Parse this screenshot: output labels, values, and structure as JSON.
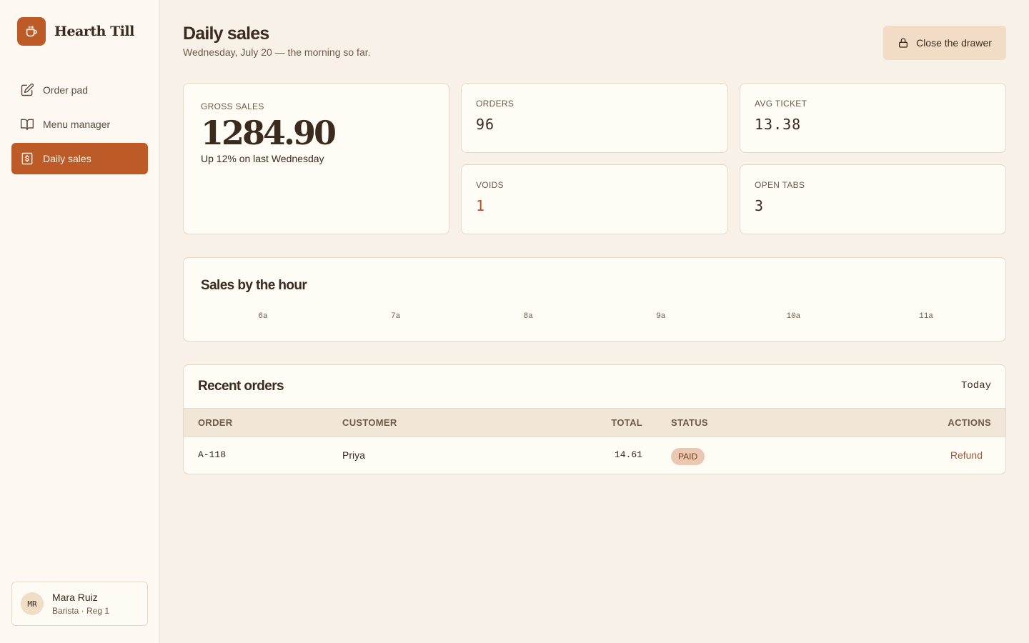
{
  "app": {
    "name": "Hearth Till"
  },
  "nav": {
    "items": [
      {
        "label": "Order pad"
      },
      {
        "label": "Menu manager"
      },
      {
        "label": "Daily sales"
      }
    ]
  },
  "user": {
    "initials": "MR",
    "name": "Mara Ruiz",
    "role": "Barista · Reg 1"
  },
  "header": {
    "title": "Daily sales",
    "subtitle": "Wednesday, July 20 — the morning so far.",
    "drawer_button": "Close the drawer"
  },
  "stats": {
    "gross": {
      "label": "Gross sales",
      "value": "1284.90",
      "note": "Up 12% on last Wednesday"
    },
    "orders": {
      "label": "Orders",
      "value": "96"
    },
    "avg_ticket": {
      "label": "Avg ticket",
      "value": "13.38"
    },
    "voids": {
      "label": "Voids",
      "value": "1"
    },
    "open_tabs": {
      "label": "Open tabs",
      "value": "3"
    }
  },
  "colors": {
    "accent": "#bc5b27",
    "void": "#b3512a"
  },
  "chart_data": {
    "type": "bar",
    "title": "Sales by the hour",
    "categories": [
      "6a",
      "7a",
      "8a",
      "9a",
      "10a",
      "11a"
    ]
  },
  "orders": {
    "title": "Recent orders",
    "filter": "Today",
    "columns": [
      "Order",
      "Customer",
      "Total",
      "Status",
      "Actions"
    ],
    "rows": [
      {
        "order": "A-118",
        "customer": "Priya",
        "total": "14.61",
        "status": "PAID",
        "action": "Refund"
      }
    ]
  }
}
